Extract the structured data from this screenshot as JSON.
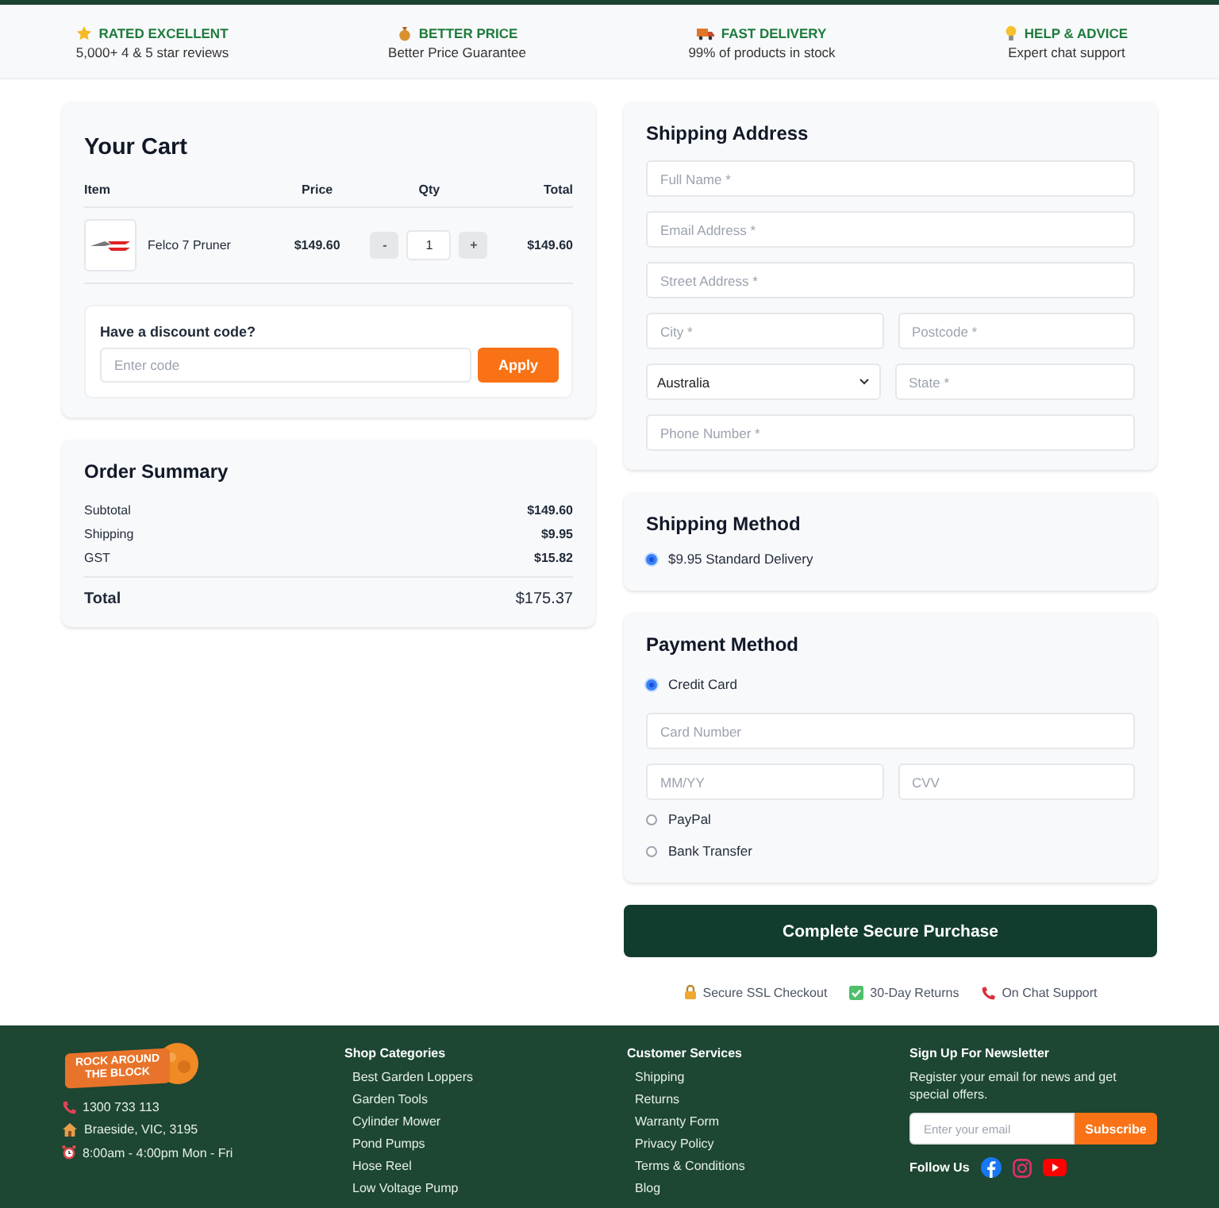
{
  "benefits": [
    {
      "title": "RATED EXCELLENT",
      "subtitle": "5,000+ 4 & 5 star reviews"
    },
    {
      "title": "BETTER PRICE",
      "subtitle": "Better Price Guarantee"
    },
    {
      "title": "FAST DELIVERY",
      "subtitle": "99% of products in stock"
    },
    {
      "title": "HELP & ADVICE",
      "subtitle": "Expert chat support"
    }
  ],
  "cart": {
    "title": "Your Cart",
    "columns": [
      "Item",
      "Price",
      "Qty",
      "Total"
    ],
    "items": [
      {
        "name": "Felco 7 Pruner",
        "price": "$149.60",
        "qty": "1",
        "total": "$149.60",
        "minus": "-",
        "plus": "+"
      }
    ],
    "discount": {
      "label": "Have a discount code?",
      "placeholder": "Enter code",
      "button": "Apply"
    }
  },
  "summary": {
    "title": "Order Summary",
    "rows": [
      {
        "label": "Subtotal",
        "value": "$149.60"
      },
      {
        "label": "Shipping",
        "value": "$9.95"
      },
      {
        "label": "GST",
        "value": "$15.82"
      }
    ],
    "total": {
      "label": "Total",
      "value": "$175.37"
    }
  },
  "shipping_address": {
    "title": "Shipping Address",
    "rows": [
      [
        {
          "kind": "input",
          "placeholder": "Full Name *"
        }
      ],
      [
        {
          "kind": "input",
          "placeholder": "Email Address *"
        }
      ],
      [
        {
          "kind": "input",
          "placeholder": "Street Address *"
        }
      ],
      [
        {
          "kind": "input",
          "placeholder": "City *"
        },
        {
          "kind": "input",
          "placeholder": "Postcode *"
        }
      ],
      [
        {
          "kind": "select",
          "value": "Australia"
        },
        {
          "kind": "input",
          "placeholder": "State *"
        }
      ],
      [
        {
          "kind": "input",
          "placeholder": "Phone Number *"
        }
      ]
    ]
  },
  "shipping_method": {
    "title": "Shipping Method",
    "options": [
      {
        "label": "$9.95 Standard Delivery",
        "selected": true
      }
    ]
  },
  "payment": {
    "title": "Payment Method",
    "options": [
      {
        "label": "Credit Card",
        "selected": true,
        "rows": [
          [
            {
              "kind": "input",
              "placeholder": "Card Number"
            }
          ],
          [
            {
              "kind": "input",
              "placeholder": "MM/YY"
            },
            {
              "kind": "input",
              "placeholder": "CVV"
            }
          ]
        ]
      },
      {
        "label": "PayPal",
        "selected": false
      },
      {
        "label": "Bank Transfer",
        "selected": false
      }
    ]
  },
  "purchase_button": "Complete Secure Purchase",
  "trust": [
    {
      "label": "Secure SSL Checkout"
    },
    {
      "label": "30-Day Returns"
    },
    {
      "label": "On Chat Support"
    }
  ],
  "footer": {
    "logo": [
      "ROCK AROUND",
      "THE BLOCK"
    ],
    "contacts": [
      {
        "text": "1300 733 113"
      },
      {
        "text": "Braeside, VIC, 3195"
      },
      {
        "text": "8:00am - 4:00pm Mon - Fri"
      }
    ],
    "columns": [
      {
        "title": "Shop Categories",
        "links": [
          "Best Garden Loppers",
          "Garden Tools",
          "Cylinder Mower",
          "Pond Pumps",
          "Hose Reel",
          "Low Voltage Pump"
        ]
      },
      {
        "title": "Customer Services",
        "links": [
          "Shipping",
          "Returns",
          "Warranty Form",
          "Privacy Policy",
          "Terms & Conditions",
          "Blog"
        ]
      }
    ],
    "newsletter": {
      "title": "Sign Up For Newsletter",
      "text": "Register your email for news and get special offers.",
      "placeholder": "Enter your email",
      "button": "Subscribe"
    },
    "follow": "Follow Us"
  }
}
